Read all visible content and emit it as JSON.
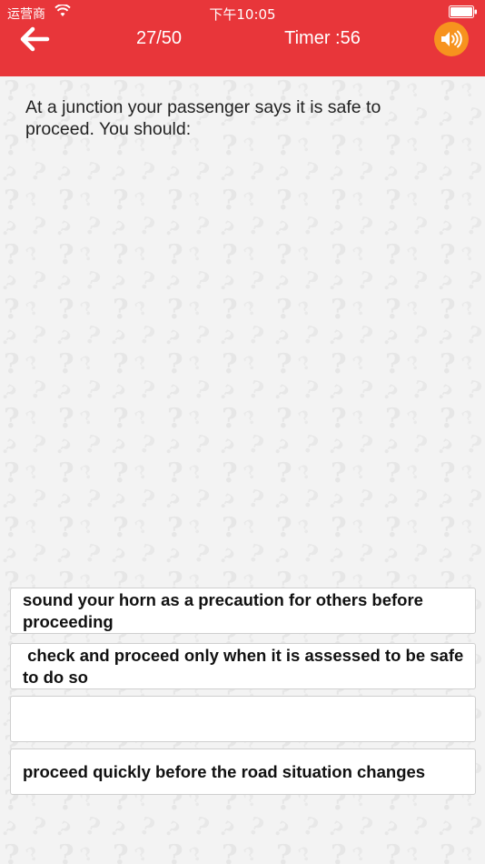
{
  "status_bar": {
    "carrier": "运营商",
    "time": "下午10:05"
  },
  "nav": {
    "progress": "27/50",
    "timer": "Timer :56",
    "back_icon": "arrow-left-icon",
    "sound_icon": "speaker-icon",
    "accent_color": "#e8363a",
    "sound_button_color": "#f7931e"
  },
  "question": {
    "text": "At a junction your passenger says it is safe to proceed. You should:"
  },
  "options": [
    {
      "text": "sound your horn as a precaution for others before proceeding"
    },
    {
      "text": " check and proceed only when it is assessed to be safe to do so"
    },
    {
      "text": ""
    },
    {
      "text": "proceed quickly before the road situation changes"
    }
  ]
}
